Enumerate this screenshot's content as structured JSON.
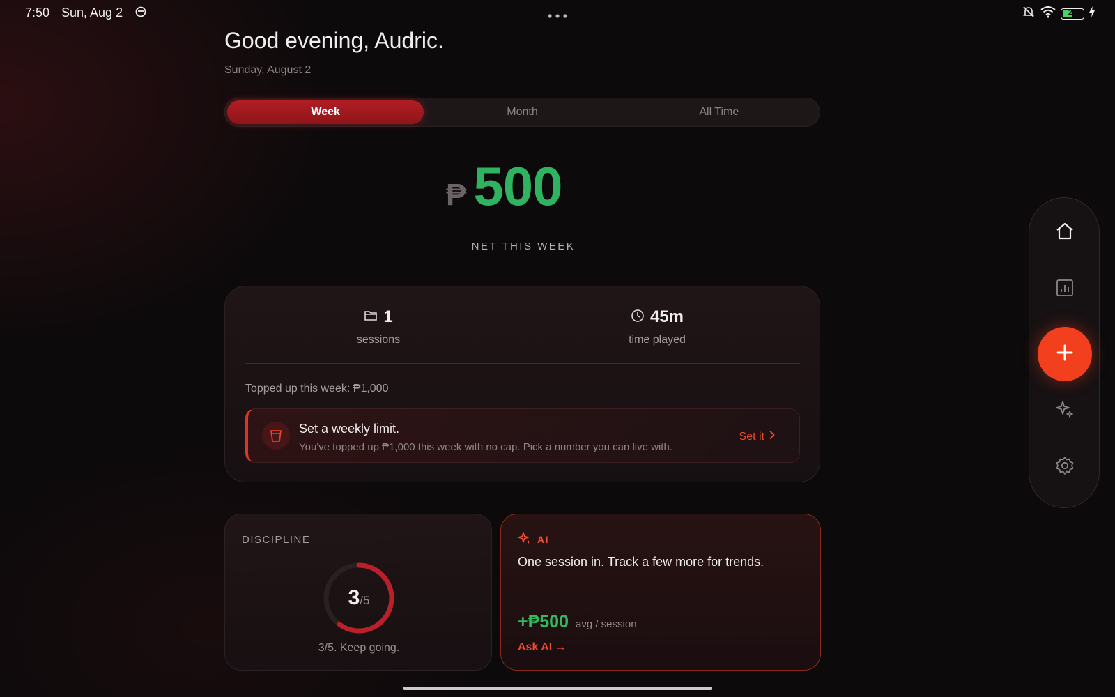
{
  "status_bar": {
    "time": "7:50",
    "date": "Sun, Aug 2",
    "battery_level": "22"
  },
  "greeting": "Good evening, Audric.",
  "date_label": "Sunday, August 2",
  "period_tabs": [
    {
      "label": "Week",
      "active": true
    },
    {
      "label": "Month",
      "active": false
    },
    {
      "label": "All Time",
      "active": false
    }
  ],
  "net": {
    "currency": "₱",
    "amount": "500",
    "label": "NET THIS WEEK",
    "color": "#2fb360"
  },
  "stats": {
    "sessions_value": "1",
    "sessions_label": "sessions",
    "time_value": "45m",
    "time_label": "time played",
    "topped_up": "Topped up this week: ₱1,000"
  },
  "limit_card": {
    "title": "Set a weekly limit.",
    "description": "You've topped up ₱1,000 this week with no cap. Pick a number you can live with.",
    "action": "Set it"
  },
  "discipline": {
    "title": "DISCIPLINE",
    "score": "3",
    "out_of": "/5",
    "score_fraction": 0.6,
    "note": "3/5. Keep going."
  },
  "ai_card": {
    "tag": "AI",
    "message": "One session in. Track a few more for trends.",
    "avg_value": "+₱500",
    "avg_label": "avg / session",
    "ask": "Ask AI →"
  },
  "side_nav": {
    "items": [
      "home-icon",
      "chart-icon",
      "add-icon",
      "sparkle-icon",
      "settings-icon"
    ],
    "accent": "#f2401f"
  }
}
